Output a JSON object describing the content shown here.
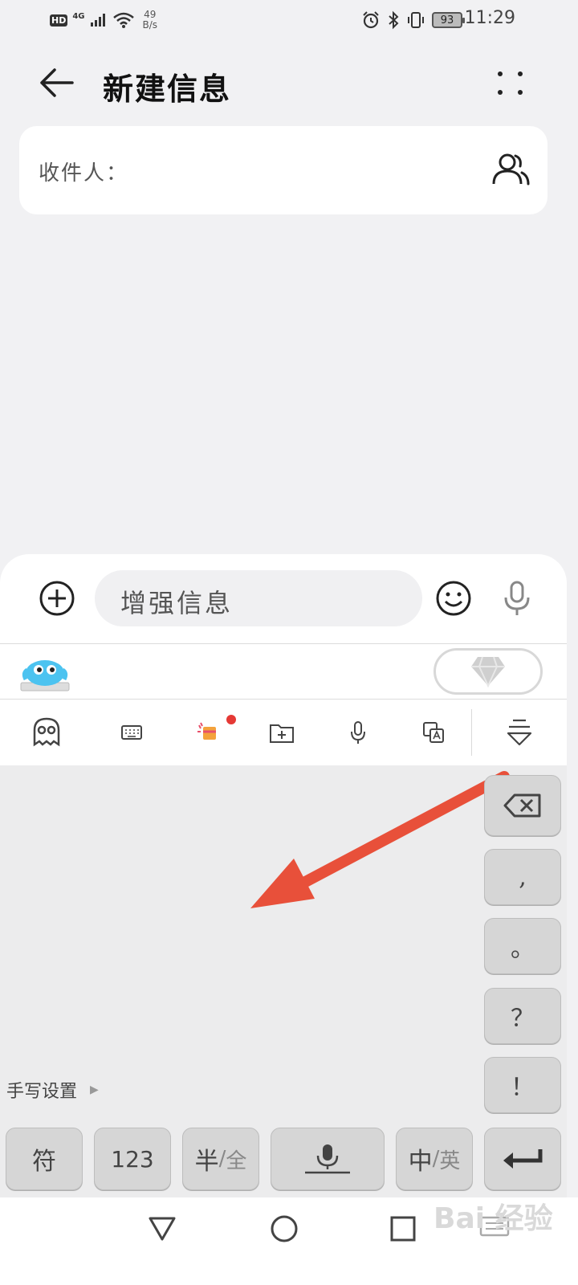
{
  "status_bar": {
    "hd": "HD",
    "network": "4G",
    "net_speed_value": "49",
    "net_speed_unit": "B/s",
    "battery": "93",
    "time": "11:29"
  },
  "header": {
    "title": "新建信息"
  },
  "recipient": {
    "label": "收件人：",
    "value": ""
  },
  "composer": {
    "placeholder": "增强信息"
  },
  "ime": {
    "toolbar_icons": [
      "mascot-icon",
      "keyboard-icon",
      "theme-icon",
      "clipboard-folder-icon",
      "voice-icon",
      "translate-icon",
      "collapse-icon"
    ],
    "handwriting_settings": "手写设置",
    "side_keys": [
      ",",
      "。",
      "？",
      "！"
    ],
    "bottom_keys": {
      "symbol": "符",
      "number": "123",
      "half": "半",
      "full": "全",
      "chinese": "中",
      "english": "英"
    }
  },
  "watermark": "Bai 经验",
  "colors": {
    "background": "#f1f1f3",
    "arrow_annotation": "#e8503a",
    "notification_dot": "#e53935"
  }
}
